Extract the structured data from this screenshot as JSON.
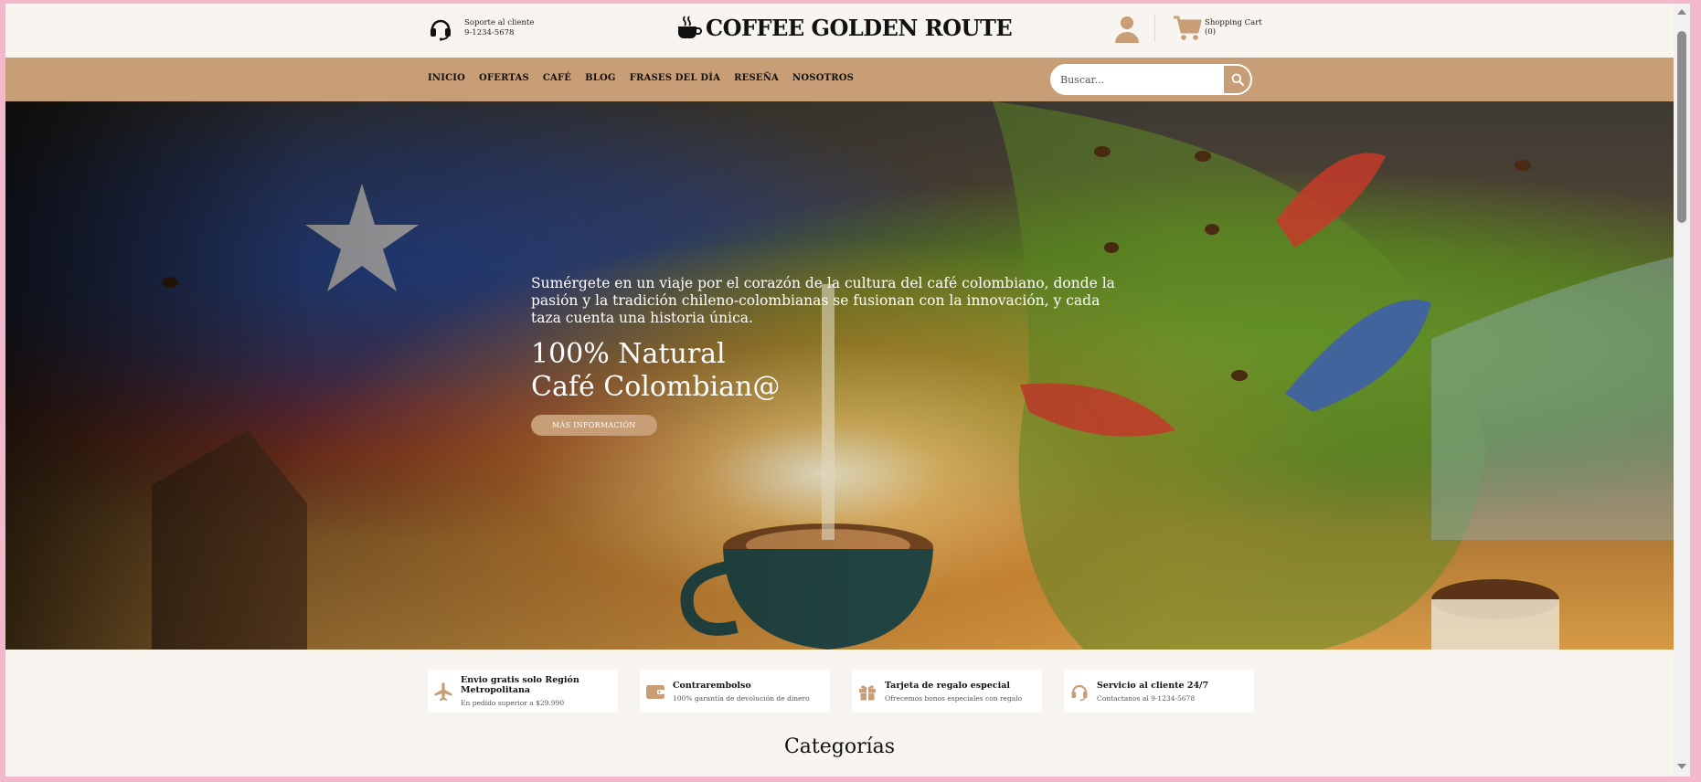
{
  "header": {
    "support_label": "Soporte al cliente",
    "support_phone": "9-1234-5678",
    "brand_name": "COFFEE GOLDEN ROUTE",
    "cart_label": "Shopping Cart",
    "cart_count": "(0)"
  },
  "nav": {
    "items": [
      "INICIO",
      "OFERTAS",
      "CAFÉ",
      "BLOG",
      "FRASES DEL DÍA",
      "RESEÑA",
      "NOSOTROS"
    ],
    "search_placeholder": "Buscar..."
  },
  "hero": {
    "lead": "Sumérgete en un viaje por el corazón de la cultura del café colombiano, donde la pasión y la tradición chileno-colombianas se fusionan con la innovación, y cada taza cuenta una historia única.",
    "title_line1": "100% Natural",
    "title_line2": "Café Colombian@",
    "button_label": "MÁS INFORMACIÓN"
  },
  "features": [
    {
      "icon": "plane-icon",
      "title": "Envio gratis solo Región Metropolitana",
      "desc": "En pedido superior a $29.990"
    },
    {
      "icon": "wallet-icon",
      "title": "Contrarembolso",
      "desc": "100% garantía de devolución de dinero"
    },
    {
      "icon": "gift-icon",
      "title": "Tarjeta de regalo especial",
      "desc": "Ofrecemos bonos especiales con regalo"
    },
    {
      "icon": "headset-icon",
      "title": "Servicio al cliente 24/7",
      "desc": "Contactanos al 9-1234-5678"
    }
  ],
  "sections": {
    "categories_title": "Categorías"
  },
  "colors": {
    "accent": "#c89e77",
    "background": "#f8f4ef",
    "frame": "#f4b8cc"
  }
}
